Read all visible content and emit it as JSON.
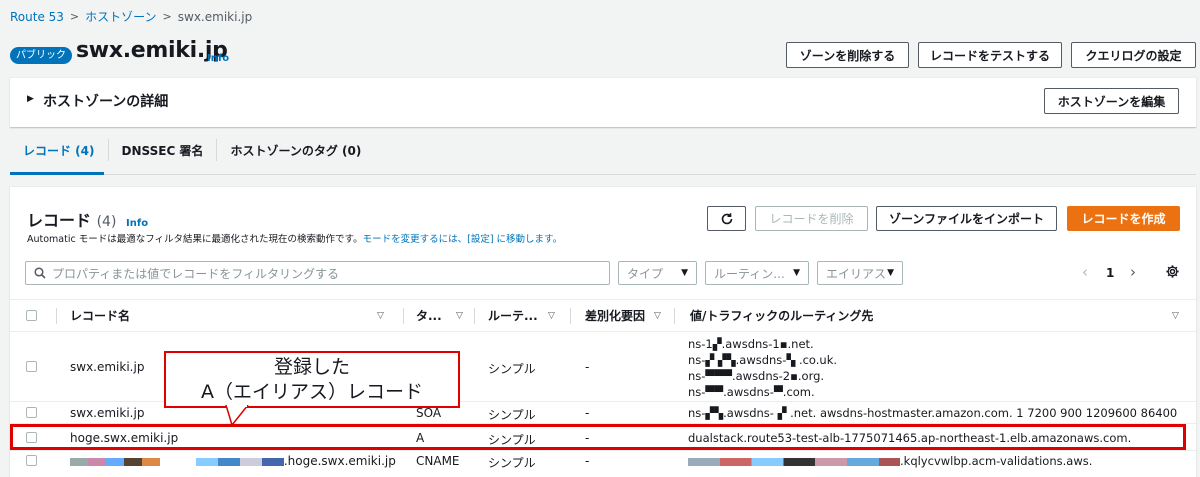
{
  "breadcrumb": {
    "root": "Route 53",
    "hosted_zones": "ホストゾーン",
    "current": "swx.emiki.jp"
  },
  "header": {
    "badge": "パブリック",
    "title": "swx.emiki.jp",
    "info": "Info",
    "buttons": {
      "delete_zone": "ゾーンを削除する",
      "test_record": "レコードをテストする",
      "query_log": "クエリログの設定"
    }
  },
  "details": {
    "title": "ホストゾーンの詳細",
    "edit_button": "ホストゾーンを編集"
  },
  "tabs": [
    {
      "label": "レコード (4)"
    },
    {
      "label": "DNSSEC 署名"
    },
    {
      "label": "ホストゾーンのタグ (0)"
    }
  ],
  "records_panel": {
    "title": "レコード",
    "count": "(4)",
    "info": "Info",
    "description_prefix": "Automatic モードは最適なフィルタ結果に最適化された現在の検索動作です。",
    "description_link": "モードを変更するには、[設定] に移動します。",
    "buttons": {
      "refresh_icon": "refresh-icon",
      "delete_record": "レコードを削除",
      "import_zone": "ゾーンファイルをインポート",
      "create_record": "レコードを作成"
    },
    "search_placeholder": "プロパティまたは値でレコードをフィルタリングする",
    "filters": {
      "type": "タイプ",
      "routing": "ルーティン...",
      "alias": "エイリアス"
    },
    "pagination": {
      "page": "1"
    }
  },
  "columns": [
    "レコード名",
    "タ...",
    "ルーテ...",
    "差別化要因",
    "値/トラフィックのルーティング先"
  ],
  "records": [
    {
      "name": "swx.emiki.jp",
      "type": "",
      "routing": "シンプル",
      "diff": "-",
      "values": [
        "ns-1▞.awsdns-1▪.net.",
        "ns-▞ ▞▚.awsdns-▚ .co.uk.",
        "ns-▀▀▀.awsdns-2▪.org.",
        "ns-▀▀.awsdns-▀.com."
      ]
    },
    {
      "name": "swx.emiki.jp",
      "type": "SOA",
      "routing": "シンプル",
      "diff": "-",
      "values": [
        "ns-▞▚.awsdns- ▞ .net. awsdns-hostmaster.amazon.com. 1 7200 900 1209600 86400"
      ]
    },
    {
      "name": "hoge.swx.emiki.jp",
      "type": "A",
      "routing": "シンプル",
      "diff": "-",
      "values": [
        "dualstack.route53-test-alb-1775071465.ap-northeast-1.elb.amazonaws.com."
      ]
    },
    {
      "name": ".hoge.swx.emiki.jp",
      "type": "CNAME",
      "routing": "シンプル",
      "diff": "-",
      "values": [
        ".kqlycvwlbp.acm-validations.aws."
      ]
    }
  ],
  "annotation": {
    "line1": "登録した",
    "line2": "A（エイリアス）レコード"
  },
  "colors": {
    "accent": "#0073bb",
    "primary": "#ec7211",
    "highlight": "#df0000"
  }
}
